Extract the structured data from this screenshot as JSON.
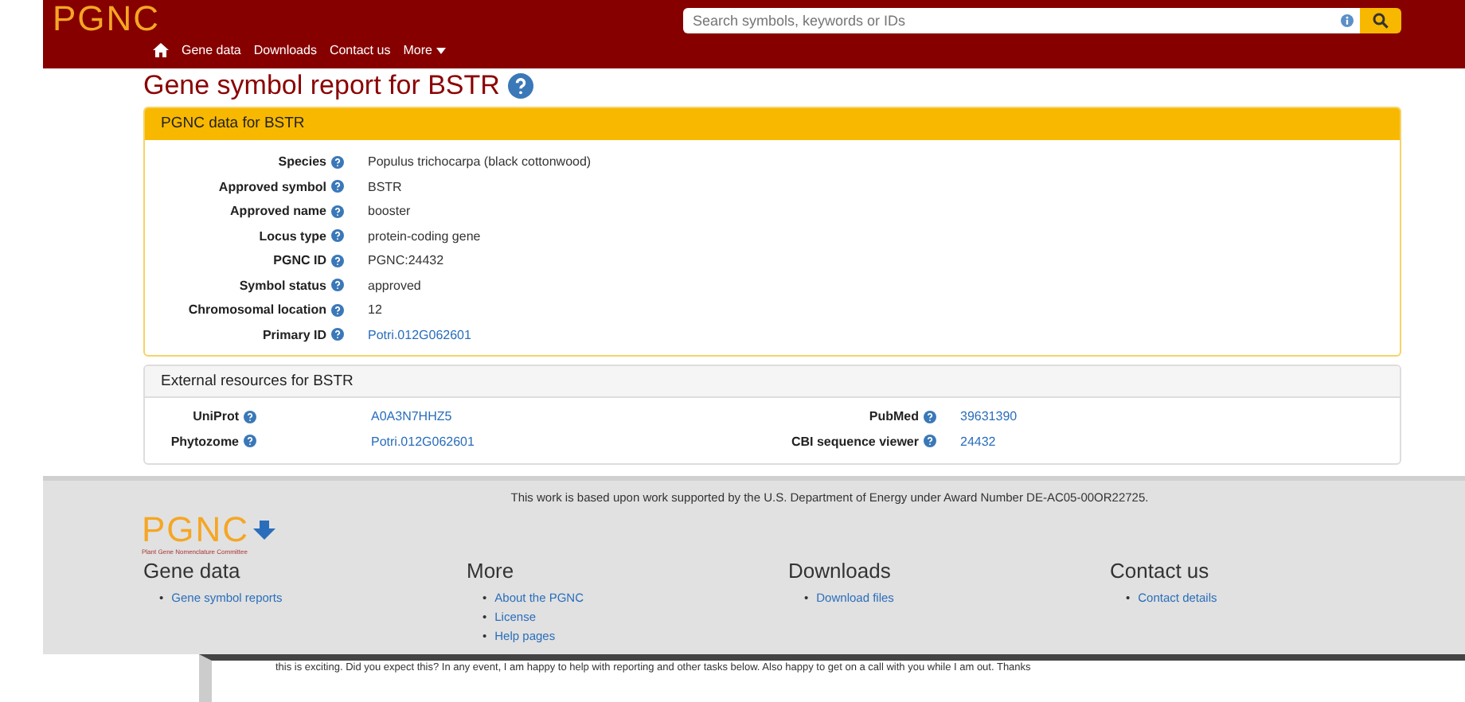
{
  "navbar": {
    "logo": "PGNC",
    "search": {
      "placeholder": "Search symbols, keywords or IDs"
    },
    "links": [
      {
        "kind": "home"
      },
      {
        "kind": "link",
        "label": "Gene data",
        "dropdown": false
      },
      {
        "kind": "link",
        "label": "Downloads",
        "dropdown": false
      },
      {
        "kind": "link",
        "label": "Contact us",
        "dropdown": false
      },
      {
        "kind": "link",
        "label": "More",
        "dropdown": true
      }
    ]
  },
  "title": "Gene symbol report for BSTR",
  "gene_panel": {
    "header": "PGNC data for BSTR",
    "rows": [
      {
        "label": "Species",
        "value": "Populus trichocarpa (black cottonwood)",
        "link": false
      },
      {
        "label": "Approved symbol",
        "value": "BSTR",
        "link": false
      },
      {
        "label": "Approved name",
        "value": "booster",
        "link": false
      },
      {
        "label": "Locus type",
        "value": "protein-coding gene",
        "link": false
      },
      {
        "label": "PGNC ID",
        "value": "PGNC:24432",
        "link": false
      },
      {
        "label": "Symbol status",
        "value": "approved",
        "link": false
      },
      {
        "label": "Chromosomal location",
        "value": "12",
        "link": false
      },
      {
        "label": "Primary ID",
        "value": "Potri.012G062601",
        "link": true
      }
    ]
  },
  "external_panel": {
    "header": "External resources for BSTR",
    "rows": [
      {
        "label": "UniProt",
        "value": "A0A3N7HHZ5",
        "link": true
      },
      {
        "label": "PubMed",
        "value": "39631390",
        "link": true
      },
      {
        "label": "Phytozome",
        "value": "Potri.012G062601",
        "link": true
      },
      {
        "label": "CBI sequence viewer",
        "value": "24432",
        "link": true
      }
    ]
  },
  "footer": {
    "funding": "This work is based upon work supported by the U.S. Department of Energy under Award Number DE-AC05-00OR22725.",
    "logo": "PGNC",
    "logo_subtitle": "Plant Gene Nomenclature Committee",
    "columns": [
      {
        "heading": "Gene data",
        "items": [
          {
            "bullet": "•",
            "text": "Gene symbol reports"
          }
        ]
      },
      {
        "heading": "More",
        "items": [
          {
            "bullet": "•",
            "text": "About the PGNC"
          },
          {
            "bullet": "•",
            "text": "License"
          },
          {
            "bullet": "•",
            "text": "Help pages"
          }
        ]
      },
      {
        "heading": "Downloads",
        "items": [
          {
            "bullet": "•",
            "text": "Download files"
          }
        ]
      },
      {
        "heading": "Contact us",
        "items": [
          {
            "bullet": "•",
            "text": "Contact details"
          }
        ]
      }
    ]
  },
  "message_strip": {
    "text": "this is exciting. Did you expect this? In any event, I am happy to help with reporting and other tasks below. Also happy to get on a call with you while I am out. Thanks"
  }
}
